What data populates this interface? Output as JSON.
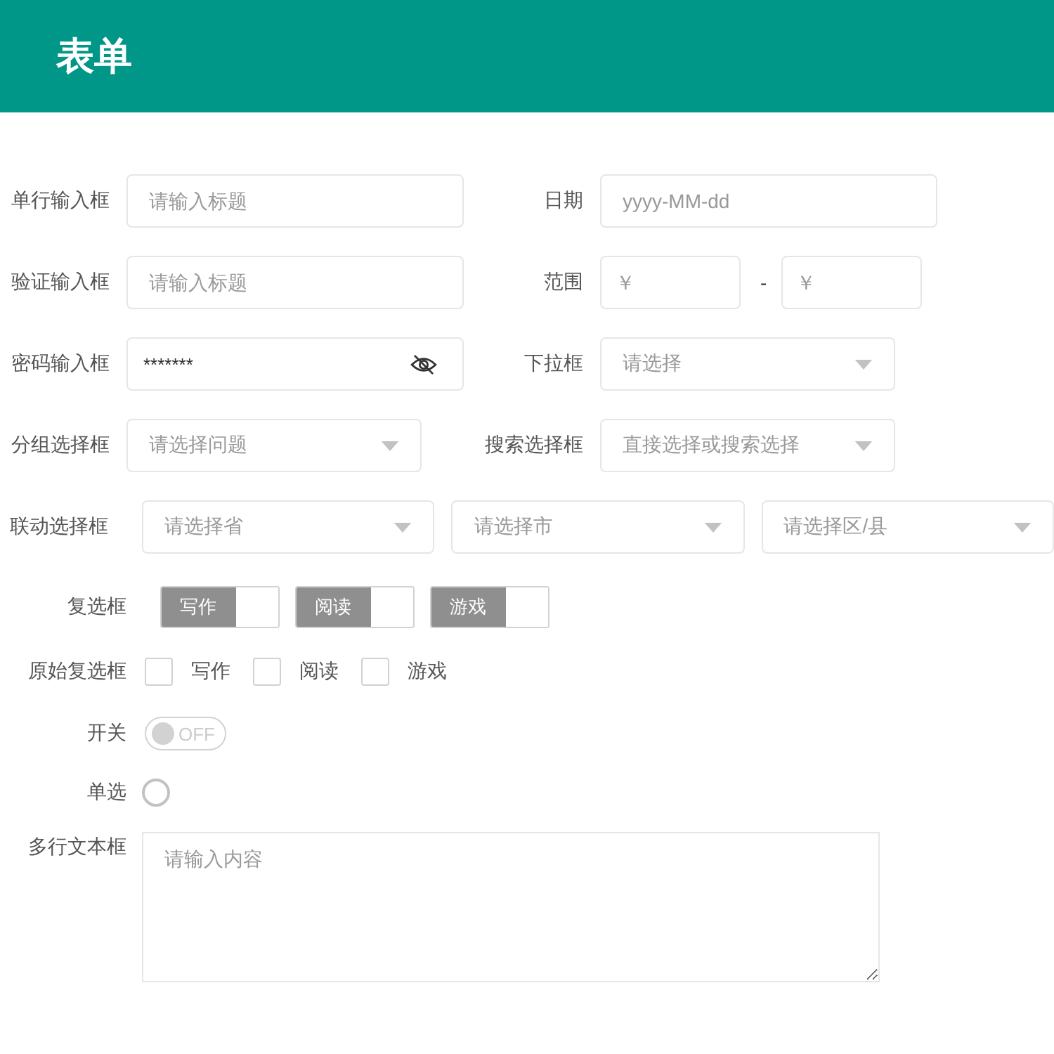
{
  "header": {
    "title": "表单"
  },
  "rows": [
    {
      "kind": "pair",
      "fields": [
        {
          "label": "单行输入框",
          "kind": "input",
          "placeholder": "请输入标题"
        },
        {
          "label": "日期",
          "kind": "input",
          "placeholder": "yyyy-MM-dd"
        }
      ]
    },
    {
      "kind": "pair",
      "fields": [
        {
          "label": "验证输入框",
          "kind": "input",
          "placeholder": "请输入标题"
        },
        {
          "label": "范围",
          "kind": "range",
          "from": {
            "placeholder": "￥"
          },
          "separator": "-",
          "to": {
            "placeholder": "￥"
          }
        }
      ]
    },
    {
      "kind": "pair",
      "fields": [
        {
          "label": "密码输入框",
          "kind": "password",
          "value": "*******"
        },
        {
          "label": "下拉框",
          "kind": "select",
          "placeholder": "请选择"
        }
      ]
    },
    {
      "kind": "pair",
      "fields": [
        {
          "label": "分组选择框",
          "kind": "select",
          "placeholder": "请选择问题"
        },
        {
          "label": "搜索选择框",
          "kind": "select",
          "placeholder": "直接选择或搜索选择"
        }
      ]
    },
    {
      "kind": "linked",
      "label": "联动选择框",
      "selects": [
        {
          "placeholder": "请选择省"
        },
        {
          "placeholder": "请选择市"
        },
        {
          "placeholder": "请选择区/县"
        }
      ]
    },
    {
      "kind": "tags",
      "label": "复选框",
      "options": [
        {
          "label": "写作",
          "checked": false
        },
        {
          "label": "阅读",
          "checked": false
        },
        {
          "label": "游戏",
          "checked": false
        }
      ]
    },
    {
      "kind": "checkboxes",
      "label": "原始复选框",
      "options": [
        {
          "label": "写作",
          "checked": false
        },
        {
          "label": "阅读",
          "checked": false
        },
        {
          "label": "游戏",
          "checked": false
        }
      ]
    },
    {
      "kind": "switch",
      "label": "开关",
      "on": false,
      "text": "OFF"
    },
    {
      "kind": "radio",
      "label": "单选",
      "selected": false
    },
    {
      "kind": "textarea",
      "label": "多行文本框",
      "placeholder": "请输入内容"
    }
  ]
}
